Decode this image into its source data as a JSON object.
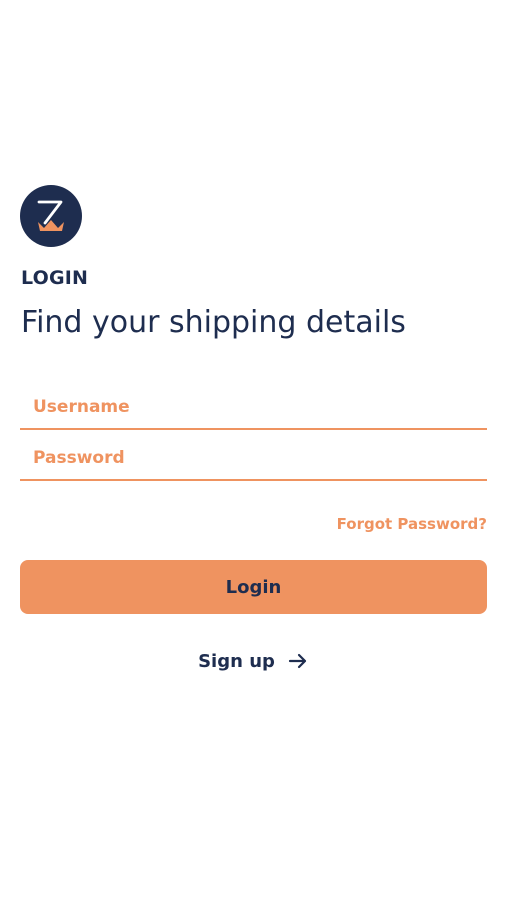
{
  "header": {
    "logo_icon": "zeta-crown-logo-icon",
    "section_label": "LOGIN",
    "subtitle": "Find your shipping details"
  },
  "form": {
    "username_placeholder": "Username",
    "username_value": "",
    "password_placeholder": "Password",
    "password_value": "",
    "forgot_password_label": "Forgot Password?",
    "login_label": "Login"
  },
  "footer": {
    "signup_label": "Sign up",
    "signup_icon": "arrow-right-icon"
  },
  "colors": {
    "navy": "#1e2d4f",
    "orange": "#ef9360",
    "background": "#ffffff"
  }
}
